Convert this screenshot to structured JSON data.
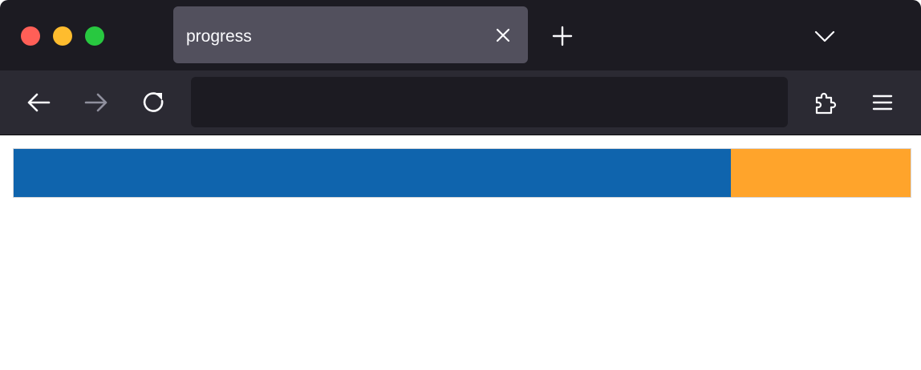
{
  "window": {
    "traffic_lights": {
      "close_color": "#ff5f57",
      "minimize_color": "#febc2e",
      "maximize_color": "#28c840"
    }
  },
  "tabs": [
    {
      "title": "progress",
      "active": true,
      "close_icon": "close-icon"
    }
  ],
  "toolbar": {
    "new_tab_icon": "plus-icon",
    "tab_list_icon": "chevron-down-icon",
    "back_icon": "arrow-left-icon",
    "forward_icon": "arrow-right-icon",
    "reload_icon": "reload-icon",
    "extensions_icon": "puzzle-icon",
    "menu_icon": "hamburger-menu-icon"
  },
  "address_bar": {
    "value": "",
    "placeholder": ""
  },
  "page": {
    "progress": {
      "fraction": 0.8,
      "fill_color": "#0f64ad",
      "track_color": "#ffa42b"
    }
  },
  "colors": {
    "tabstrip_bg": "#1c1b22",
    "toolbar_bg": "#2b2a33",
    "active_tab_bg": "#52505d"
  }
}
